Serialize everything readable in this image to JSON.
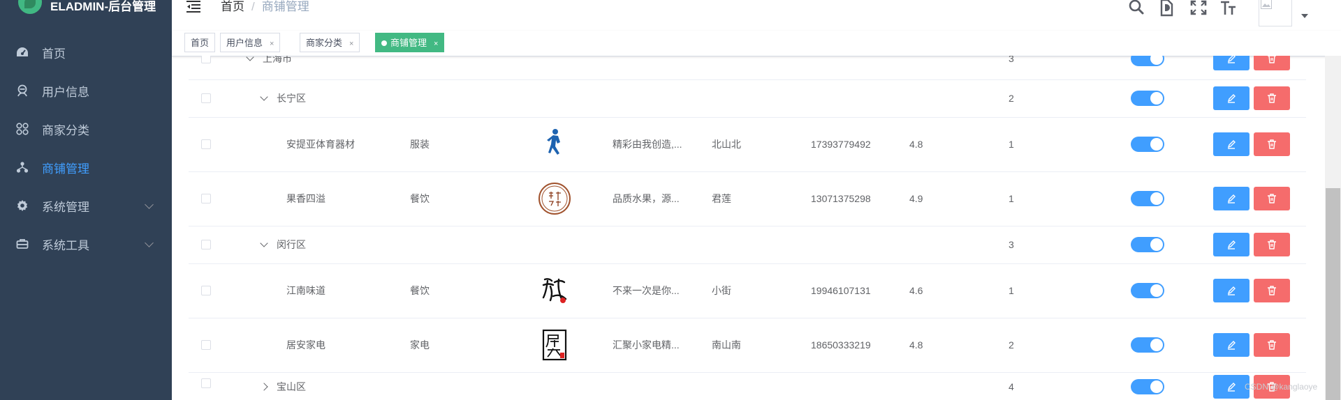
{
  "app": {
    "title": "ELADMIN-后台管理"
  },
  "sidebar": {
    "items": [
      {
        "label": "首页",
        "icon": "dashboard-icon",
        "active": false,
        "has_submenu": false
      },
      {
        "label": "用户信息",
        "icon": "user-icon",
        "active": false,
        "has_submenu": false
      },
      {
        "label": "商家分类",
        "icon": "grid-icon",
        "active": false,
        "has_submenu": false
      },
      {
        "label": "商铺管理",
        "icon": "tree-icon",
        "active": true,
        "has_submenu": false
      },
      {
        "label": "系统管理",
        "icon": "gear-icon",
        "active": false,
        "has_submenu": true
      },
      {
        "label": "系统工具",
        "icon": "tools-icon",
        "active": false,
        "has_submenu": true
      }
    ]
  },
  "navbar": {
    "breadcrumb": {
      "home": "首页",
      "separator": "/",
      "current": "商铺管理"
    },
    "tools": [
      "search-icon",
      "document-icon",
      "fullscreen-icon",
      "font-size-icon"
    ]
  },
  "tags": [
    {
      "label": "首页",
      "closable": false,
      "active": false
    },
    {
      "label": "用户信息",
      "closable": true,
      "active": false
    },
    {
      "label": "商家分类",
      "closable": true,
      "active": false
    },
    {
      "label": "商铺管理",
      "closable": true,
      "active": true
    }
  ],
  "tag_close_glyph": "×",
  "table": {
    "rows": [
      {
        "type": "group",
        "name": "上海市",
        "count": "3",
        "expanded": true,
        "enabled": true
      },
      {
        "type": "group",
        "name": "长宁区",
        "count": "2",
        "expanded": true,
        "enabled": true
      },
      {
        "type": "shop",
        "name": "安提亚体育器材",
        "category": "服装",
        "logo": "athlete-logo",
        "desc": "精彩由我创造,...",
        "address": "北山北",
        "phone": "17393779492",
        "rating": "4.8",
        "count": "1",
        "enabled": true
      },
      {
        "type": "shop",
        "name": "果香四溢",
        "category": "餐饮",
        "logo": "fruit-seal-logo",
        "desc": "品质水果，源...",
        "address": "君莲",
        "phone": "13071375298",
        "rating": "4.9",
        "count": "1",
        "enabled": true
      },
      {
        "type": "group",
        "name": "闵行区",
        "count": "3",
        "expanded": true,
        "enabled": true
      },
      {
        "type": "shop",
        "name": "江南味道",
        "category": "餐饮",
        "logo": "calligraphy-logo",
        "desc": "不来一次是你...",
        "address": "小街",
        "phone": "19946107131",
        "rating": "4.6",
        "count": "1",
        "enabled": true
      },
      {
        "type": "shop",
        "name": "居安家电",
        "category": "家电",
        "logo": "juan-seal-logo",
        "desc": "汇聚小家电精...",
        "address": "南山南",
        "phone": "18650333219",
        "rating": "4.8",
        "count": "2",
        "enabled": true
      },
      {
        "type": "group",
        "name": "宝山区",
        "count": "4",
        "expanded": false,
        "enabled": true
      }
    ]
  },
  "watermark": "CSDN @kanglaoye",
  "colors": {
    "sidebar_bg": "#304156",
    "active": "#409eff",
    "tag_active": "#42b983",
    "danger": "#f56c6c"
  }
}
